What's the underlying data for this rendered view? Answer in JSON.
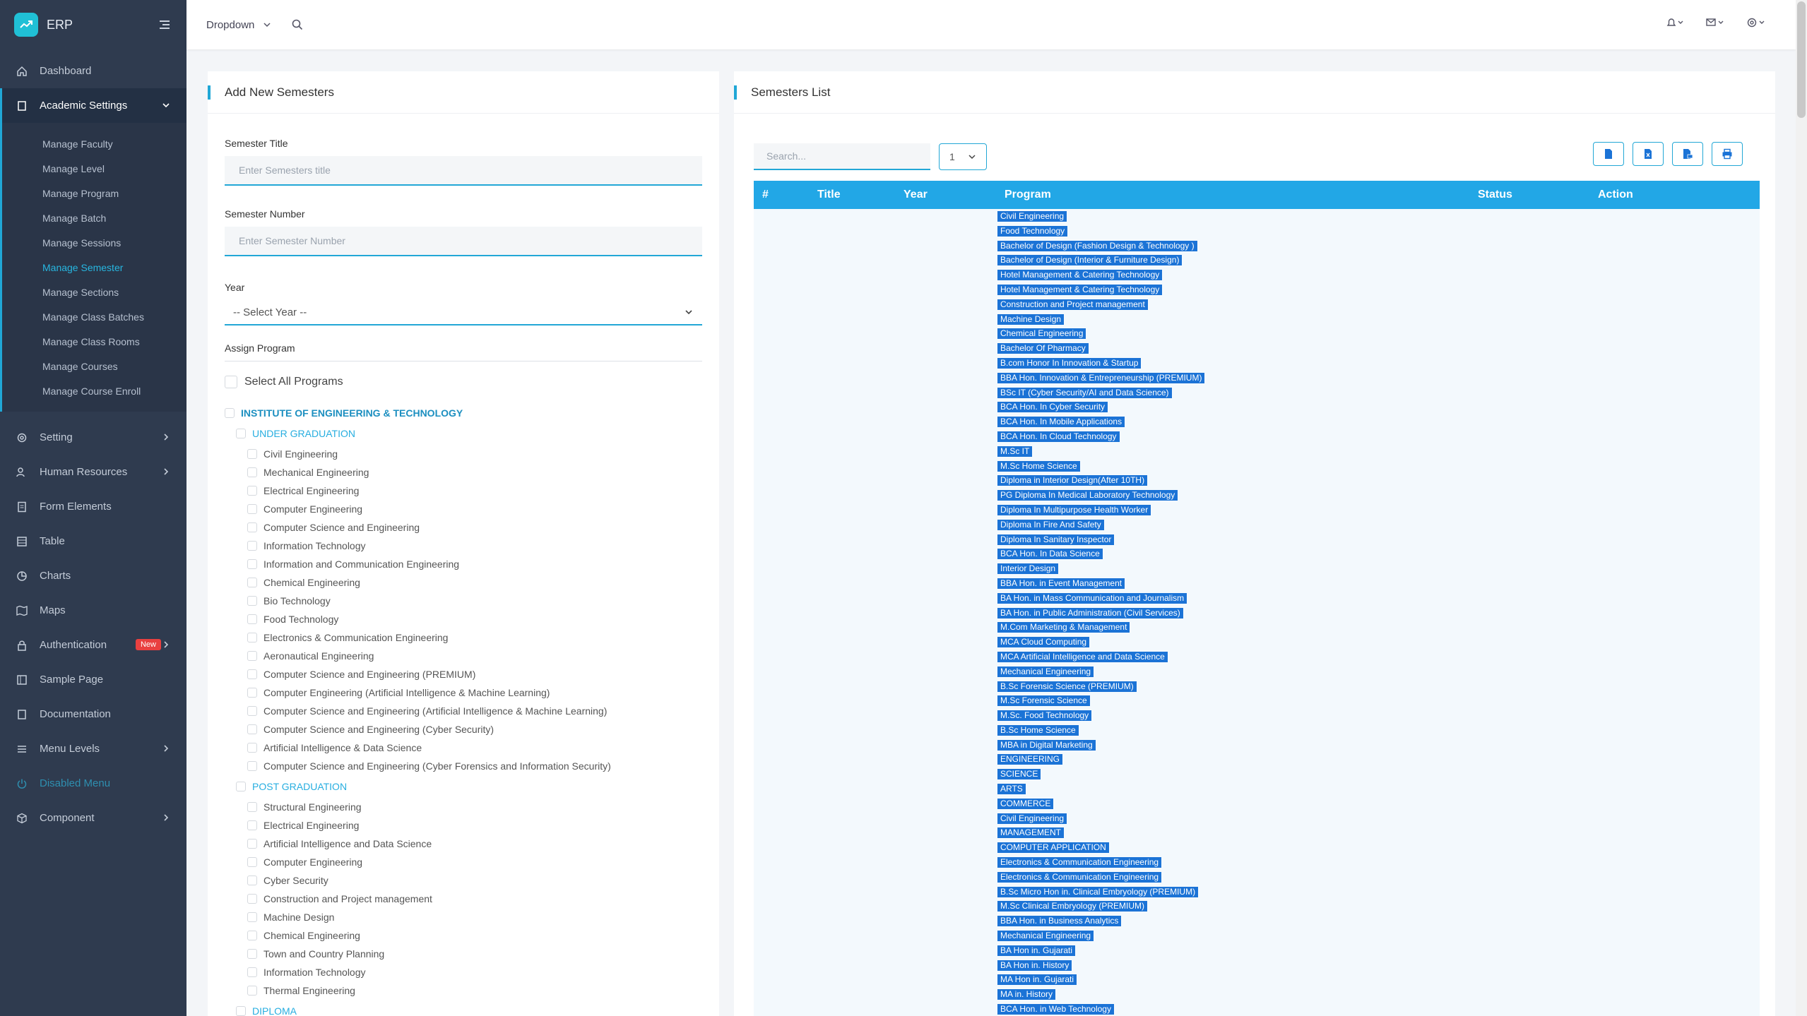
{
  "app": {
    "name": "ERP"
  },
  "sidebar": {
    "items": [
      {
        "label": "Dashboard",
        "icon": "home-icon"
      },
      {
        "label": "Academic Settings",
        "icon": "book-icon"
      },
      {
        "label": "Setting",
        "icon": "gear-icon"
      },
      {
        "label": "Human Resources",
        "icon": "users-icon"
      },
      {
        "label": "Form Elements",
        "icon": "document-icon"
      },
      {
        "label": "Table",
        "icon": "table-icon"
      },
      {
        "label": "Charts",
        "icon": "pie-chart-icon"
      },
      {
        "label": "Maps",
        "icon": "map-icon"
      },
      {
        "label": "Authentication",
        "icon": "lock-icon",
        "badge": "New"
      },
      {
        "label": "Sample Page",
        "icon": "page-icon"
      },
      {
        "label": "Documentation",
        "icon": "book-icon"
      },
      {
        "label": "Menu Levels",
        "icon": "menu-icon"
      },
      {
        "label": "Disabled Menu",
        "icon": "power-icon"
      },
      {
        "label": "Component",
        "icon": "box-icon"
      }
    ],
    "academic_sub": [
      "Manage Faculty",
      "Manage Level",
      "Manage Program",
      "Manage Batch",
      "Manage Sessions",
      "Manage Semester",
      "Manage Sections",
      "Manage Class Batches",
      "Manage Class Rooms",
      "Manage Courses",
      "Manage Course Enroll"
    ]
  },
  "topbar": {
    "dropdown_label": "Dropdown"
  },
  "form": {
    "title": "Add New Semesters",
    "semester_title_label": "Semester Title",
    "semester_title_placeholder": "Enter Semesters title",
    "semester_number_label": "Semester Number",
    "semester_number_placeholder": "Enter Semester Number",
    "year_label": "Year",
    "year_selected": "-- Select Year --",
    "assign_label": "Assign Program",
    "select_all": "Select All Programs",
    "institute": "INSTITUTE OF ENGINEERING & TECHNOLOGY",
    "ug_label": "UNDER GRADUATION",
    "ug_programs": [
      "Civil Engineering",
      "Mechanical Engineering",
      "Electrical Engineering",
      "Computer Engineering",
      "Computer Science and Engineering",
      "Information Technology",
      "Information and Communication Engineering",
      "Chemical Engineering",
      "Bio Technology",
      "Food Technology",
      "Electronics & Communication Engineering",
      "Aeronautical Engineering",
      "Computer Science and Engineering (PREMIUM)",
      "Computer Engineering (Artificial Intelligence & Machine Learning)",
      "Computer Science and Engineering (Artificial Intelligence & Machine Learning)",
      "Computer Science and Engineering (Cyber Security)",
      "Artificial Intelligence & Data Science",
      "Computer Science and Engineering (Cyber Forensics and Information Security)"
    ],
    "pg_label": "POST GRADUATION",
    "pg_programs": [
      "Structural Engineering",
      "Electrical Engineering",
      "Artificial Intelligence and Data Science",
      "Computer Engineering",
      "Cyber Security",
      "Construction and Project management",
      "Machine Design",
      "Chemical Engineering",
      "Town and Country Planning",
      "Information Technology",
      "Thermal Engineering"
    ],
    "diploma_label": "DIPLOMA"
  },
  "list": {
    "title": "Semesters List",
    "search_placeholder": "Search...",
    "page_size": "1",
    "columns": [
      "#",
      "Title",
      "Year",
      "Program",
      "Status",
      "Action"
    ],
    "programs": [
      "Civil Engineering",
      "Food Technology",
      "Bachelor of Design (Fashion Design & Technology )",
      "Bachelor of Design (Interior & Furniture Design)",
      "Hotel Management & Catering Technology",
      "Hotel Management & Catering Technology",
      "Construction and Project management",
      "Machine Design",
      "Chemical Engineering",
      "Bachelor Of Pharmacy",
      "B.com Honor In Innovation & Startup",
      "BBA Hon. Innovation & Entrepreneurship (PREMIUM)",
      "BSc IT (Cyber Security/AI and Data Science)",
      "BCA Hon. In Cyber Security",
      "BCA Hon. In Mobile Applications",
      "BCA Hon. In Cloud Technology",
      "M.Sc IT",
      "M.Sc Home Science",
      "Diploma in Interior Design(After 10TH)",
      "PG Diploma In Medical Laboratory Technology",
      "Diploma In Multipurpose Health Worker",
      "Diploma In Fire And Safety",
      "Diploma In Sanitary Inspector",
      "BCA Hon. In Data Science",
      "Interior Design",
      "BBA Hon. in Event Management",
      "BA Hon. in Mass Communication and Journalism",
      "BA Hon. in Public Administration (Civil Services)",
      "M.Com Marketing & Management",
      "MCA Cloud Computing",
      "MCA Artificial Intelligence and Data Science",
      "Mechanical Engineering",
      "B.Sc Forensic Science (PREMIUM)",
      "M.Sc Forensic Science",
      "M.Sc. Food Technology",
      "B.Sc Home Science",
      "MBA in Digital Marketing",
      "ENGINEERING",
      "SCIENCE",
      "ARTS",
      "COMMERCE",
      "Civil Engineering",
      "MANAGEMENT",
      "COMPUTER APPLICATION",
      "Electronics & Communication Engineering",
      "Electronics & Communication Engineering",
      "B.Sc Micro Hon in. Clinical Embryology (PREMIUM)",
      "M.Sc Clinical Embryology (PREMIUM)",
      "BBA Hon. in Business Analytics",
      "Mechanical Engineering",
      "BA Hon in. Gujarati",
      "BA Hon in. History",
      "MA Hon in. Gujarati",
      "MA in. History",
      "BCA Hon. in Web Technology"
    ]
  },
  "colors": {
    "accent": "#20a7d6",
    "sidebar": "#2f3b4f",
    "tag": "#1b73d6",
    "header": "#22a7e6"
  }
}
